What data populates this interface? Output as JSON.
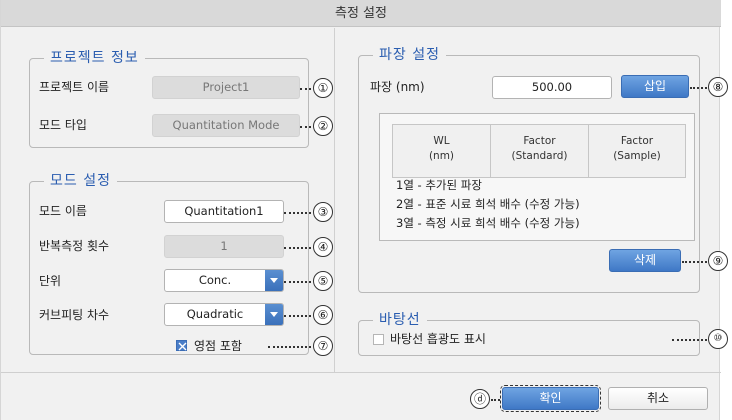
{
  "window": {
    "title": "측정 설정"
  },
  "project_info": {
    "title": "프로젝트 정보",
    "name_label": "프로젝트 이름",
    "name_value": "Project1",
    "mode_type_label": "모드 타입",
    "mode_type_value": "Quantitation Mode"
  },
  "mode_settings": {
    "title": "모드 설정",
    "mode_name_label": "모드 이름",
    "mode_name_value": "Quantitation1",
    "repeat_label": "반복측정 횟수",
    "repeat_value": "1",
    "unit_label": "단위",
    "unit_value": "Conc.",
    "curve_label": "커브피팅 차수",
    "curve_value": "Quadratic",
    "include_zero_label": "영점 포함",
    "include_zero_checked": true
  },
  "wavelength": {
    "title": "파장 설정",
    "label": "파장 (nm)",
    "value": "500.00",
    "insert_button": "삽입",
    "delete_button": "삭제",
    "table_headers": [
      {
        "line1": "WL",
        "line2": "(nm)"
      },
      {
        "line1": "Factor",
        "line2": "(Standard)"
      },
      {
        "line1": "Factor",
        "line2": "(Sample)"
      }
    ],
    "notes": [
      "1열 - 추가된 파장",
      "2열 - 표준 시료 희석 배수 (수정 가능)",
      "3열 - 측정 시료 희석 배수 (수정 가능)"
    ]
  },
  "baseline": {
    "title": "바탕선",
    "show_label": "바탕선 흡광도 표시",
    "show_checked": false
  },
  "footer": {
    "ok_button": "확인",
    "cancel_button": "취소"
  },
  "callouts": {
    "c1": "①",
    "c2": "②",
    "c3": "③",
    "c4": "④",
    "c5": "⑤",
    "c6": "⑥",
    "c7": "⑦",
    "c8": "⑧",
    "c9": "⑨",
    "c10": "⑩",
    "cd": "ⓓ"
  }
}
